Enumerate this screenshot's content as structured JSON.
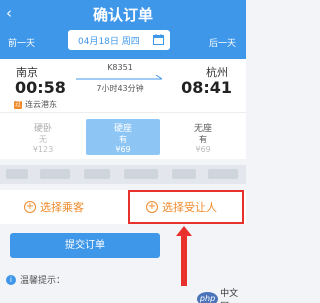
{
  "header": {
    "title": "确认订单",
    "prev_day": "前一天",
    "next_day": "后一天",
    "date": "04月18日 周四",
    "back_icon": "back-arrow-icon",
    "calendar_icon": "calendar-icon"
  },
  "train": {
    "from_city": "南京",
    "to_city": "杭州",
    "depart_time": "00:58",
    "arrive_time": "08:41",
    "train_no": "K8351",
    "duration": "7小时43分钟",
    "station_tag": "过",
    "station_name": "连云港东"
  },
  "seats": [
    {
      "name": "硬卧",
      "availability": "无",
      "price": "¥123"
    },
    {
      "name": "硬座",
      "availability": "有",
      "price": "¥69"
    },
    {
      "name": "无座",
      "availability": "有",
      "price": "¥69"
    }
  ],
  "actions": {
    "select_passenger": "选择乘客",
    "select_transferee": "选择受让人",
    "plus_icon": "plus-circle-icon"
  },
  "submit_label": "提交订单",
  "tip": {
    "label": "温馨提示：",
    "icon": "info-icon"
  },
  "watermark": {
    "logo_text": "php",
    "site": "中文网"
  },
  "colors": {
    "primary": "#3f97ea",
    "accent": "#f08a2a",
    "highlight": "#e8302d"
  }
}
